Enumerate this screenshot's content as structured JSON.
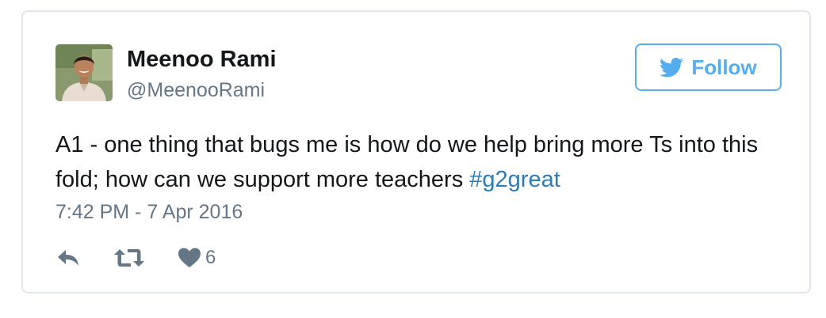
{
  "tweet": {
    "author": {
      "name": "Meenoo Rami",
      "handle": "@MeenooRami"
    },
    "follow_button": {
      "label": "Follow",
      "icon": "twitter-bird-icon"
    },
    "text": "A1 - one thing that bugs me is how do we help bring more Ts into this fold; how can we support more teachers ",
    "hashtag": "#g2great",
    "timestamp": "7:42 PM - 7 Apr 2016",
    "actions": {
      "reply_icon": "reply-icon",
      "retweet_icon": "retweet-icon",
      "like_icon": "heart-icon",
      "like_count": "6"
    },
    "colors": {
      "accent": "#55acee",
      "link": "#2b7bb9",
      "text": "#14171a",
      "muted": "#657786",
      "border": "#e1e8ed"
    }
  }
}
